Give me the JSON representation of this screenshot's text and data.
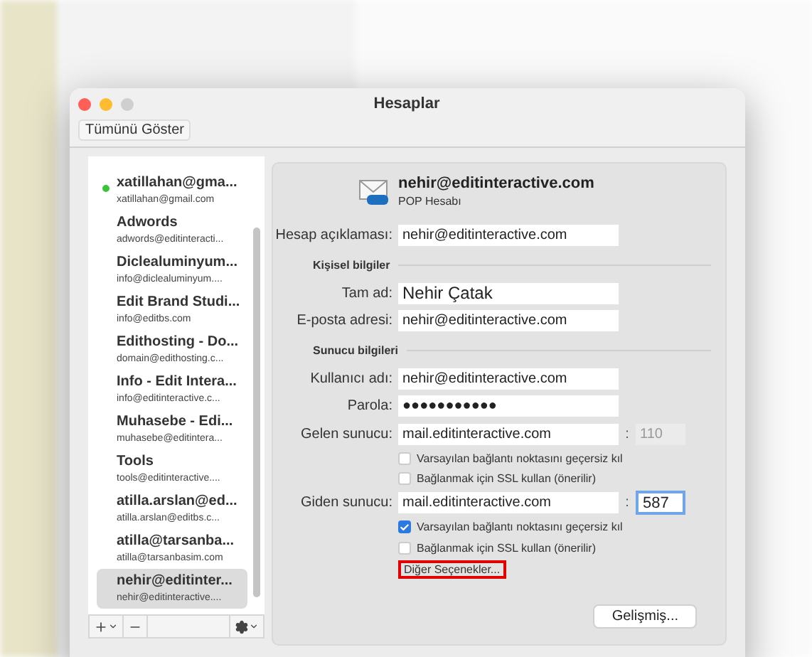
{
  "window": {
    "title": "Hesaplar",
    "toolbar_button": "Tümünü Göster"
  },
  "accounts": [
    {
      "name": "xatillahan@gma...",
      "email": "xatillahan@gmail.com",
      "online": true,
      "selected": false
    },
    {
      "name": "Adwords",
      "email": "adwords@editinteracti...",
      "online": false,
      "selected": false
    },
    {
      "name": "Diclealuminyum...",
      "email": "info@diclealuminyum....",
      "online": false,
      "selected": false
    },
    {
      "name": "Edit Brand Studi...",
      "email": "info@editbs.com",
      "online": false,
      "selected": false
    },
    {
      "name": "Edithosting - Do...",
      "email": "domain@edithosting.c...",
      "online": false,
      "selected": false
    },
    {
      "name": "Info - Edit Intera...",
      "email": "info@editinteractive.c...",
      "online": false,
      "selected": false
    },
    {
      "name": "Muhasebe - Edi...",
      "email": "muhasebe@editintera...",
      "online": false,
      "selected": false
    },
    {
      "name": "Tools",
      "email": "tools@editinteractive....",
      "online": false,
      "selected": false
    },
    {
      "name": "atilla.arslan@ed...",
      "email": "atilla.arslan@editbs.c...",
      "online": false,
      "selected": false
    },
    {
      "name": "atilla@tarsanba...",
      "email": "atilla@tarsanbasim.com",
      "online": false,
      "selected": false
    },
    {
      "name": "nehir@editinter...",
      "email": "nehir@editinteractive....",
      "online": false,
      "selected": true
    }
  ],
  "account_header": {
    "title": "nehir@editinteractive.com",
    "subtitle": "POP Hesabı"
  },
  "form": [
    {
      "kind": "field",
      "label": "Hesap açıklaması:",
      "value": "nehir@editinteractive.com"
    },
    {
      "kind": "section",
      "label": "Kişisel bilgiler"
    },
    {
      "kind": "field",
      "label": "Tam ad:",
      "value": "Nehir Çatak"
    },
    {
      "kind": "field",
      "label": "E-posta adresi:",
      "value": "nehir@editinteractive.com"
    },
    {
      "kind": "section",
      "label": "Sunucu bilgileri"
    },
    {
      "kind": "field",
      "label": "Kullanıcı adı:",
      "value": "nehir@editinteractive.com"
    },
    {
      "kind": "field",
      "label": "Parola:",
      "value": "●●●●●●●●●●●"
    },
    {
      "kind": "server",
      "label": "Gelen sunucu:",
      "value": "mail.editinteractive.com",
      "separator": ":",
      "port": "110",
      "port_disabled": true,
      "port_focused": false
    },
    {
      "kind": "checkbox",
      "label": "Varsayılan bağlantı noktasını geçersiz kıl",
      "checked": false
    },
    {
      "kind": "checkbox",
      "label": "Bağlanmak için SSL kullan (önerilir)",
      "checked": false
    },
    {
      "kind": "server",
      "label": "Giden sunucu:",
      "value": "mail.editinteractive.com",
      "separator": ":",
      "port": "587",
      "port_disabled": false,
      "port_focused": true
    },
    {
      "kind": "checkbox",
      "label": "Varsayılan bağlantı noktasını geçersiz kıl",
      "checked": true
    },
    {
      "kind": "checkbox",
      "label": "Bağlanmak için SSL kullan (önerilir)",
      "checked": false
    },
    {
      "kind": "link",
      "label": "Diğer Seçenekler...",
      "highlighted": true
    }
  ],
  "advanced_button": "Gelişmiş..."
}
